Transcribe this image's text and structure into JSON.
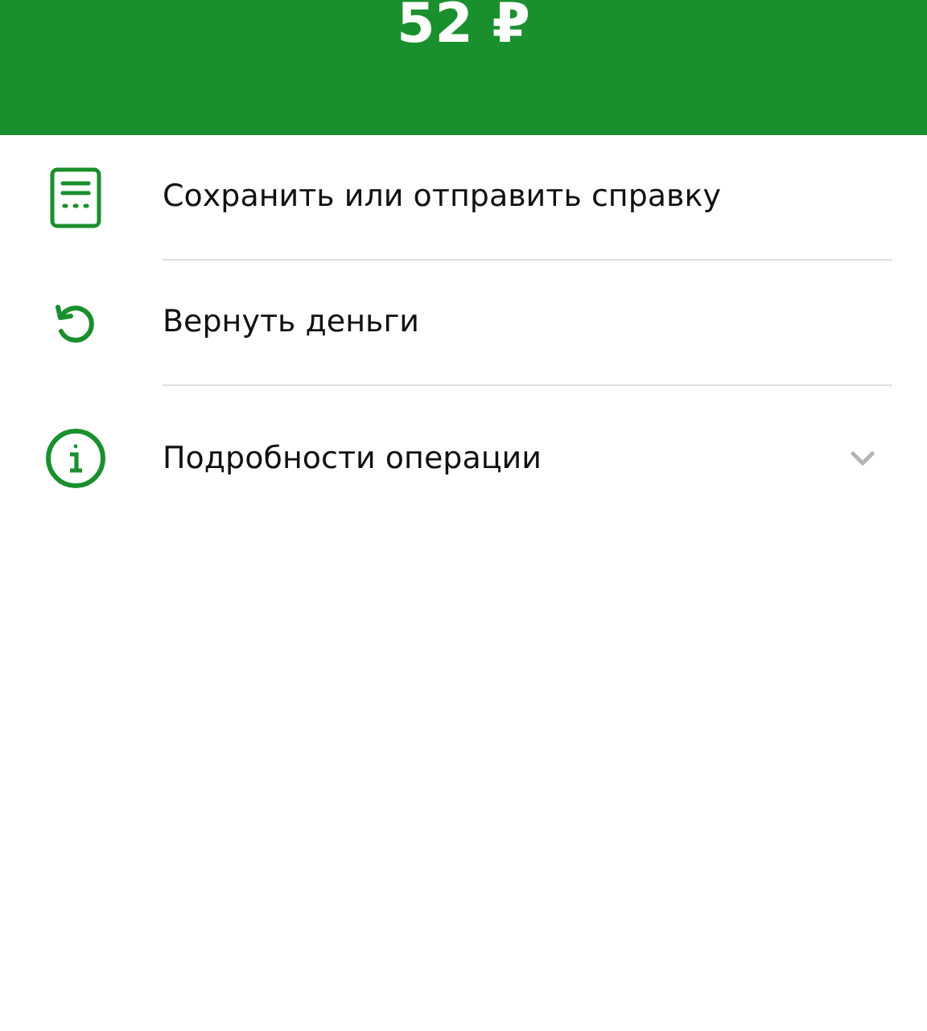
{
  "header": {
    "amount": "52 ₽"
  },
  "actions": [
    {
      "kind": "document",
      "label": "Сохранить или отправить справку"
    },
    {
      "kind": "refund",
      "label": "Вернуть деньги"
    },
    {
      "kind": "info",
      "label": "Подробности операции",
      "expanded": false
    }
  ]
}
